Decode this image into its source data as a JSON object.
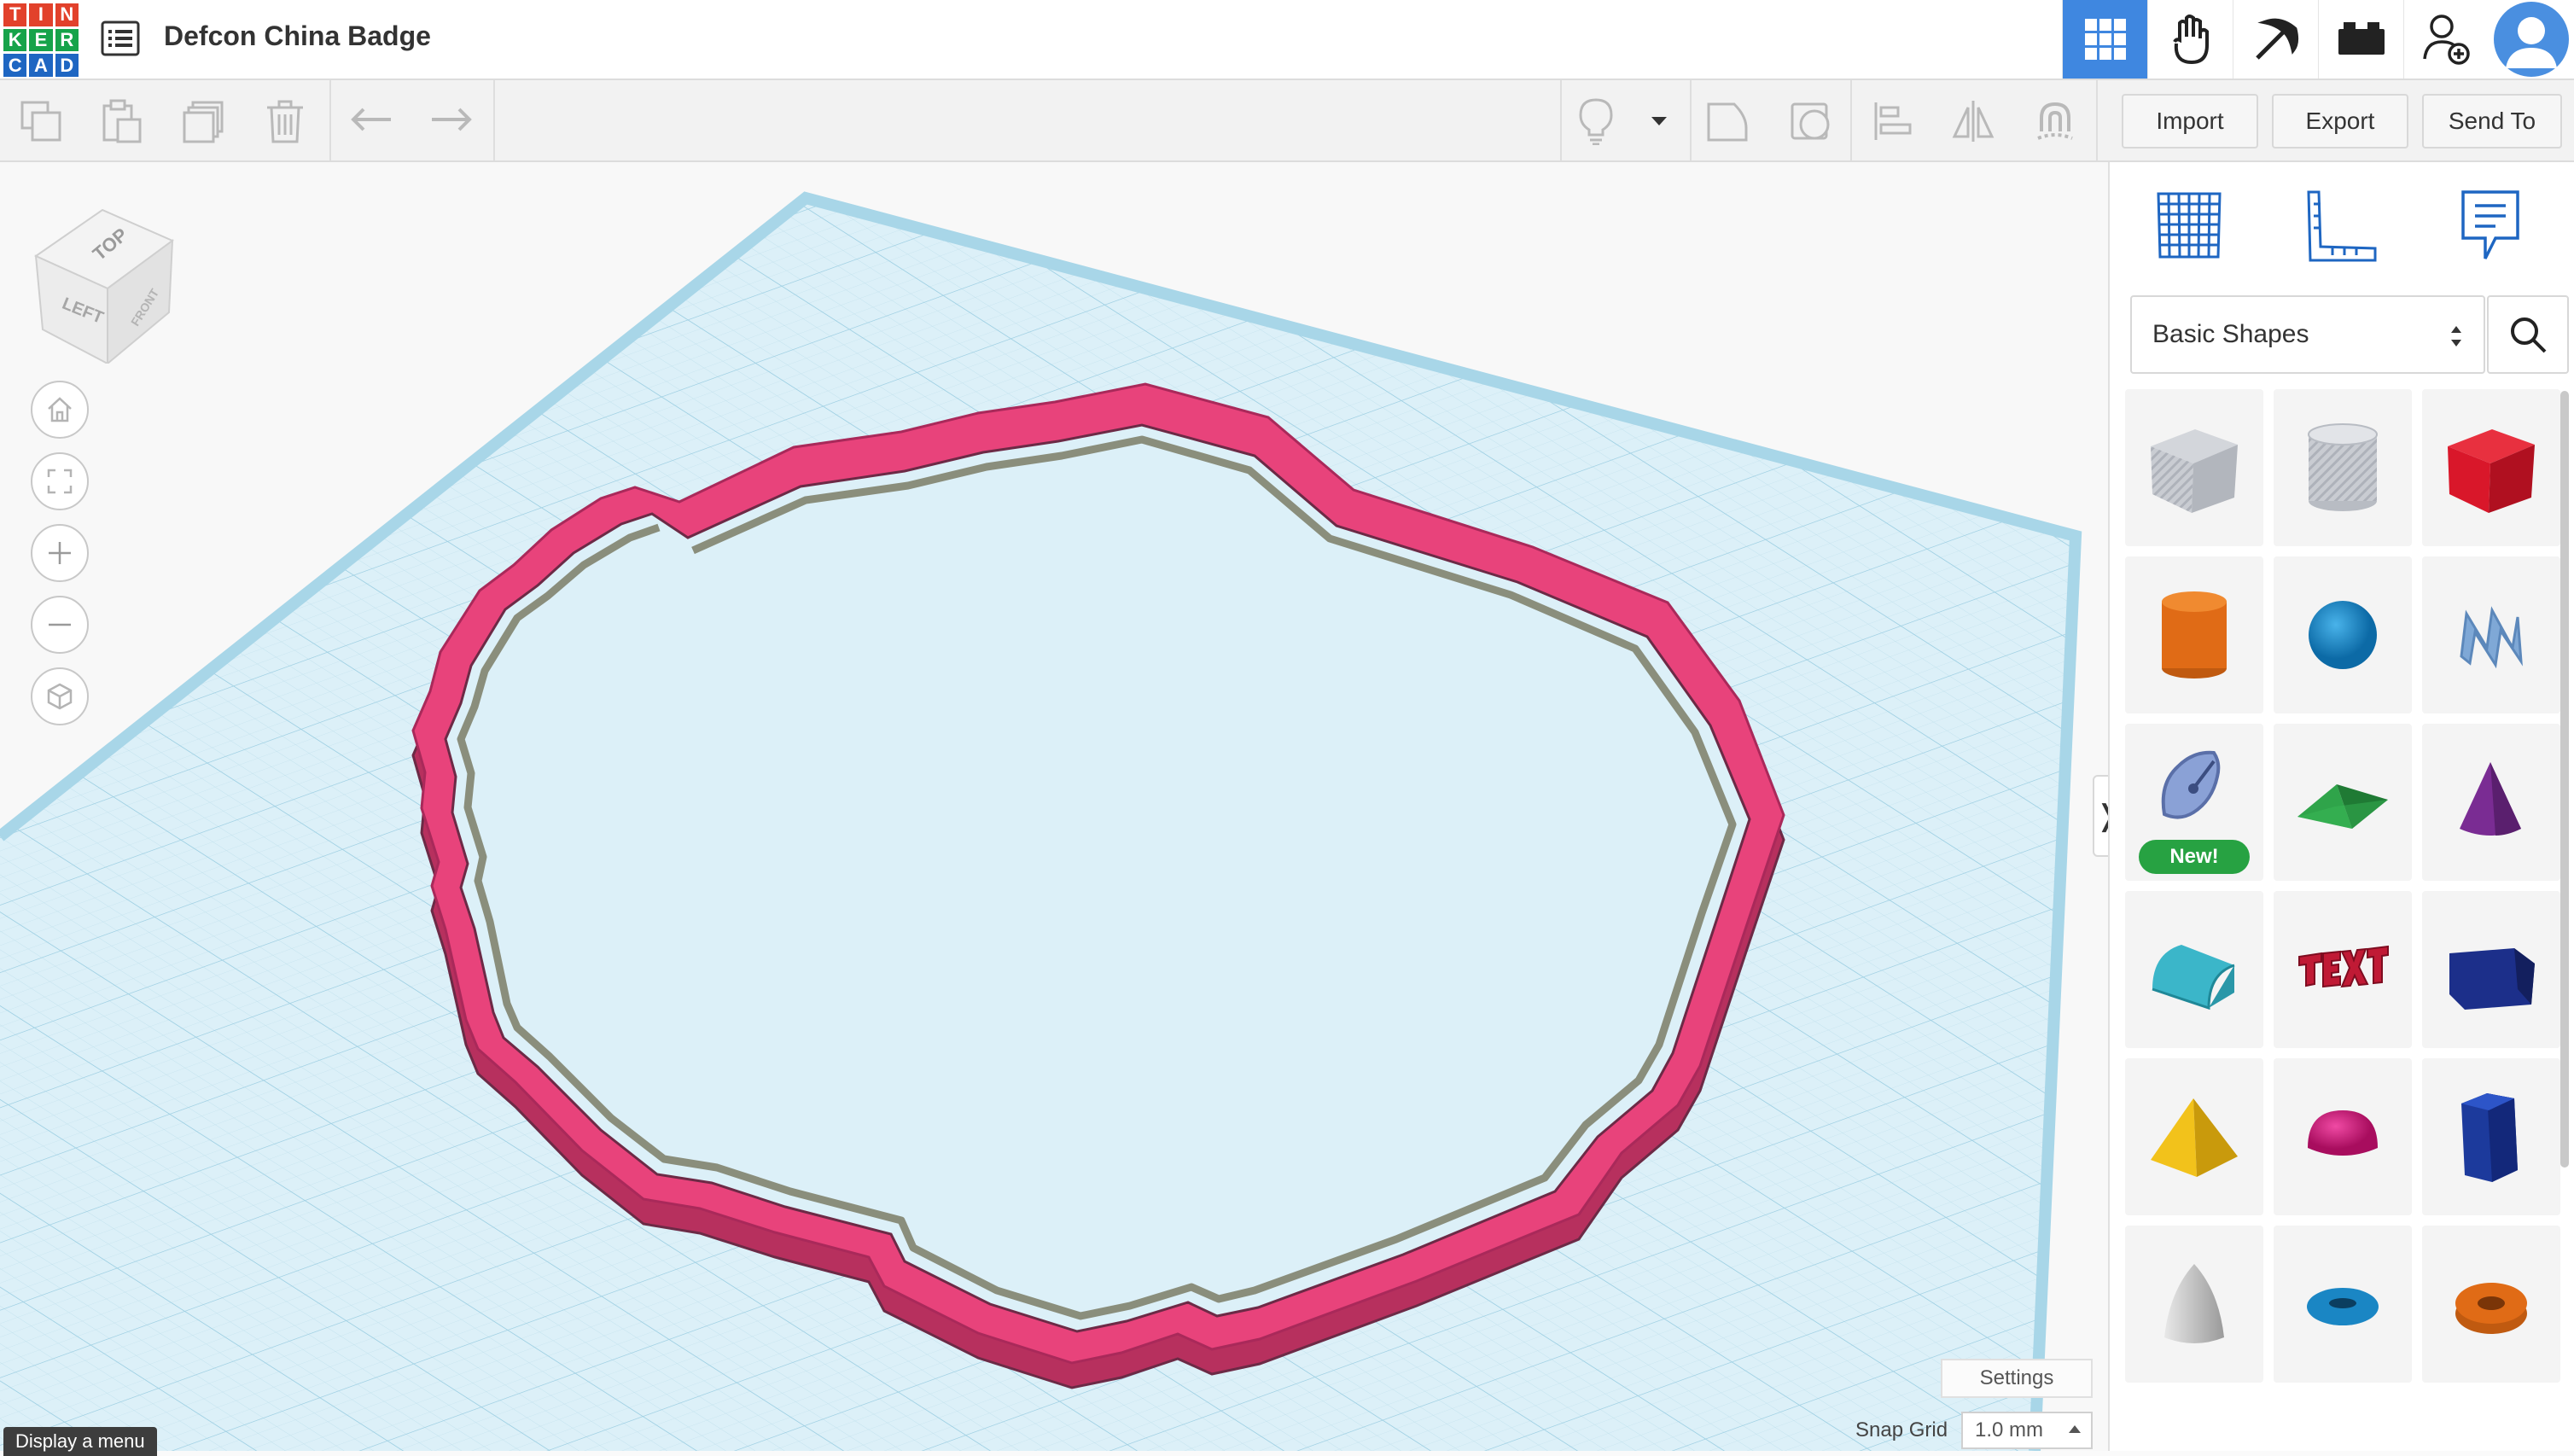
{
  "header": {
    "logo_letters": [
      "T",
      "I",
      "N",
      "K",
      "E",
      "R",
      "C",
      "A",
      "D"
    ],
    "logo_colors": [
      "#e2412b",
      "#e2412b",
      "#e2412b",
      "#16a34a",
      "#16a34a",
      "#16a34a",
      "#1e66c2",
      "#1e66c2",
      "#1e66c2"
    ],
    "design_title": "Defcon China Badge",
    "icons": [
      "grid-view-icon",
      "tinker-hand-icon",
      "pickaxe-icon",
      "bricks-icon",
      "add-user-icon",
      "user-avatar-icon"
    ]
  },
  "toolbar": {
    "left_icons": [
      "copy-icon",
      "paste-icon",
      "duplicate-icon",
      "delete-icon",
      "undo-icon",
      "redo-icon"
    ],
    "right_icons": [
      "light-bulb-icon",
      "dropdown-arrow-icon",
      "note-icon",
      "group-shape-icon",
      "align-icon",
      "mirror-icon",
      "magnet-icon"
    ],
    "import_label": "Import",
    "export_label": "Export",
    "send_to_label": "Send To"
  },
  "viewcube": {
    "top_label": "TOP",
    "left_label": "LEFT",
    "front_label": "FRONT"
  },
  "nav_buttons": [
    "home-icon",
    "fit-view-icon",
    "zoom-in-icon",
    "zoom-out-icon",
    "perspective-icon"
  ],
  "workplane": {
    "settings_label": "Settings",
    "snap_grid_label": "Snap Grid",
    "snap_grid_value": "1.0 mm",
    "tooltip": "Display a menu",
    "collapse_glyph": "❭",
    "colors": {
      "grid_bg": "#d9eef6",
      "grid_line": "#b7dbe9",
      "shape_top": "#e8437b",
      "shape_side": "#b7305e",
      "shape_inner": "#8a8e7c"
    }
  },
  "panel": {
    "icons": [
      "workplane-grid-icon",
      "ruler-icon",
      "notes-icon"
    ],
    "category_label": "Basic Shapes",
    "new_label": "New!",
    "shapes": [
      {
        "name": "box-hole",
        "color": "#b8bcc4"
      },
      {
        "name": "cylinder-hole",
        "color": "#c4c8ce"
      },
      {
        "name": "box",
        "color": "#d9172a"
      },
      {
        "name": "cylinder",
        "color": "#e06b16"
      },
      {
        "name": "sphere",
        "color": "#1281c3"
      },
      {
        "name": "scribble",
        "color": "#7fa8d6"
      },
      {
        "name": "shape-generator",
        "color": "#8aa1d6"
      },
      {
        "name": "roof",
        "color": "#2fa44a"
      },
      {
        "name": "cone",
        "color": "#7a2c93"
      },
      {
        "name": "round-roof",
        "color": "#3bb6c9"
      },
      {
        "name": "text",
        "color": "#c01a35"
      },
      {
        "name": "wedge",
        "color": "#1c2f8a"
      },
      {
        "name": "pyramid",
        "color": "#f2c21b"
      },
      {
        "name": "half-sphere",
        "color": "#d4127a"
      },
      {
        "name": "polygon",
        "color": "#1c3a9c"
      },
      {
        "name": "paraboloid",
        "color": "#c9c9c9"
      },
      {
        "name": "torus",
        "color": "#1a86c4"
      },
      {
        "name": "tube",
        "color": "#e06b16"
      }
    ]
  }
}
